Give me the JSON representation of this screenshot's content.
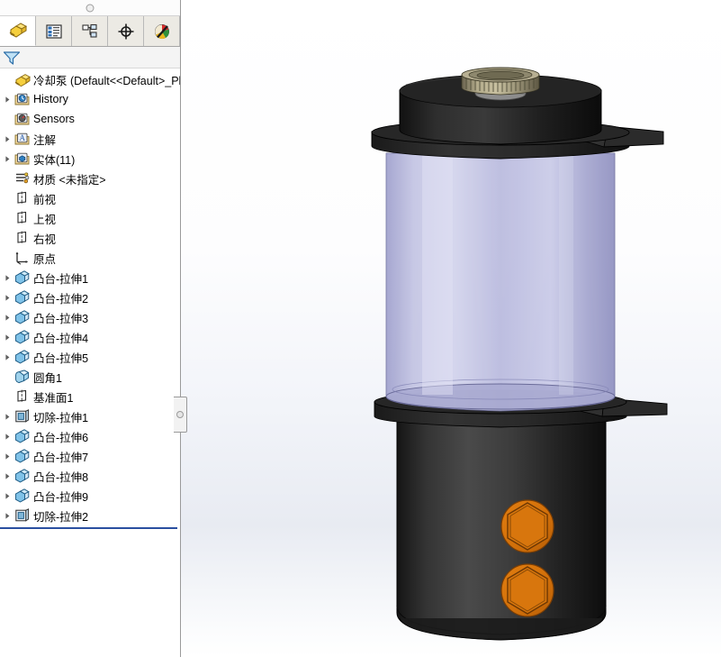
{
  "window": {
    "app": "SolidWorks",
    "grip_label": "panel-collapse-handle"
  },
  "tabs": [
    {
      "id": "feature-manager",
      "label": "FeatureManager 设计树",
      "icon": "yellow-block-icon",
      "active": true
    },
    {
      "id": "property-manager",
      "label": "PropertyManager",
      "icon": "property-list-icon",
      "active": false
    },
    {
      "id": "configuration-manager",
      "label": "ConfigurationManager",
      "icon": "configuration-icon",
      "active": false
    },
    {
      "id": "dimxpert-manager",
      "label": "DimXpertManager",
      "icon": "crosshair-icon",
      "active": false
    },
    {
      "id": "display-manager",
      "label": "DisplayManager",
      "icon": "color-sphere-icon",
      "active": false
    }
  ],
  "filter": {
    "icon": "filter-funnel-icon",
    "placeholder": ""
  },
  "tree": {
    "root": {
      "label": "冷却泵  (Default<<Default>_Ph",
      "icon": "part-icon",
      "has_arrow": false
    },
    "items": [
      {
        "label": "History",
        "icon": "history-folder-icon",
        "arrow": true,
        "indent": 1
      },
      {
        "label": "Sensors",
        "icon": "sensors-folder-icon",
        "arrow": false,
        "indent": 1
      },
      {
        "label": "注解",
        "icon": "annotations-folder-icon",
        "arrow": true,
        "indent": 1
      },
      {
        "label": "实体(11)",
        "icon": "solid-bodies-folder-icon",
        "arrow": true,
        "indent": 1
      },
      {
        "label": "材质 <未指定>",
        "icon": "material-icon",
        "arrow": false,
        "indent": 1
      },
      {
        "label": "前视",
        "icon": "plane-icon",
        "arrow": false,
        "indent": 1
      },
      {
        "label": "上视",
        "icon": "plane-icon",
        "arrow": false,
        "indent": 1
      },
      {
        "label": "右视",
        "icon": "plane-icon",
        "arrow": false,
        "indent": 1
      },
      {
        "label": "原点",
        "icon": "origin-icon",
        "arrow": false,
        "indent": 1
      },
      {
        "label": "凸台-拉伸1",
        "icon": "boss-extrude-icon",
        "arrow": true,
        "indent": 1
      },
      {
        "label": "凸台-拉伸2",
        "icon": "boss-extrude-icon",
        "arrow": true,
        "indent": 1
      },
      {
        "label": "凸台-拉伸3",
        "icon": "boss-extrude-icon",
        "arrow": true,
        "indent": 1
      },
      {
        "label": "凸台-拉伸4",
        "icon": "boss-extrude-icon",
        "arrow": true,
        "indent": 1
      },
      {
        "label": "凸台-拉伸5",
        "icon": "boss-extrude-icon",
        "arrow": true,
        "indent": 1
      },
      {
        "label": "圆角1",
        "icon": "fillet-icon",
        "arrow": false,
        "indent": 1
      },
      {
        "label": "基准面1",
        "icon": "plane-icon",
        "arrow": false,
        "indent": 1
      },
      {
        "label": "切除-拉伸1",
        "icon": "cut-extrude-icon",
        "arrow": true,
        "indent": 1
      },
      {
        "label": "凸台-拉伸6",
        "icon": "boss-extrude-icon",
        "arrow": true,
        "indent": 1
      },
      {
        "label": "凸台-拉伸7",
        "icon": "boss-extrude-icon",
        "arrow": true,
        "indent": 1
      },
      {
        "label": "凸台-拉伸8",
        "icon": "boss-extrude-icon",
        "arrow": true,
        "indent": 1
      },
      {
        "label": "凸台-拉伸9",
        "icon": "boss-extrude-icon",
        "arrow": true,
        "indent": 1
      },
      {
        "label": "切除-拉伸2",
        "icon": "cut-extrude-icon",
        "arrow": true,
        "indent": 1
      }
    ],
    "rollback_bar": true
  },
  "viewport": {
    "name": "graphics-area",
    "background_top": "#ffffff",
    "background_mid": "#e8ebf2",
    "model_name": "冷却泵",
    "parts": {
      "top_gear": {
        "name": "knurled-gear",
        "color": "#a9a286"
      },
      "cap": {
        "name": "top-cap",
        "color": "#1b1b1b"
      },
      "upper_flange": {
        "name": "upper-flange",
        "color": "#242424"
      },
      "glass_cylinder": {
        "name": "translucent-cylinder",
        "color": "#b3b4d8"
      },
      "lower_flange": {
        "name": "lower-flange",
        "color": "#232323"
      },
      "body": {
        "name": "lower-body",
        "color": "#2c2c2c"
      },
      "bolts": [
        {
          "name": "hex-bolt-upper",
          "color": "#d2700a"
        },
        {
          "name": "hex-bolt-lower",
          "color": "#d2700a"
        }
      ]
    }
  }
}
